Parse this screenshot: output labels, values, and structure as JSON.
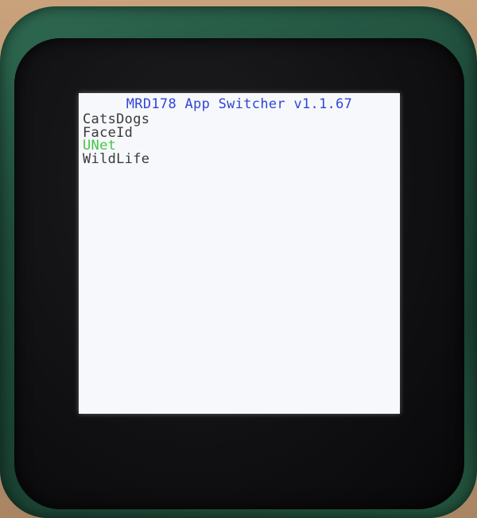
{
  "app_switcher": {
    "title": "MRD178 App Switcher v1.1.67",
    "title_color": "#2f45d8",
    "selected_color": "#46c646",
    "normal_color": "#3a3a3a",
    "apps": [
      {
        "label": "CatsDogs",
        "selected": false
      },
      {
        "label": "FaceId",
        "selected": false
      },
      {
        "label": "UNet",
        "selected": true
      },
      {
        "label": "WildLife",
        "selected": false
      }
    ]
  }
}
